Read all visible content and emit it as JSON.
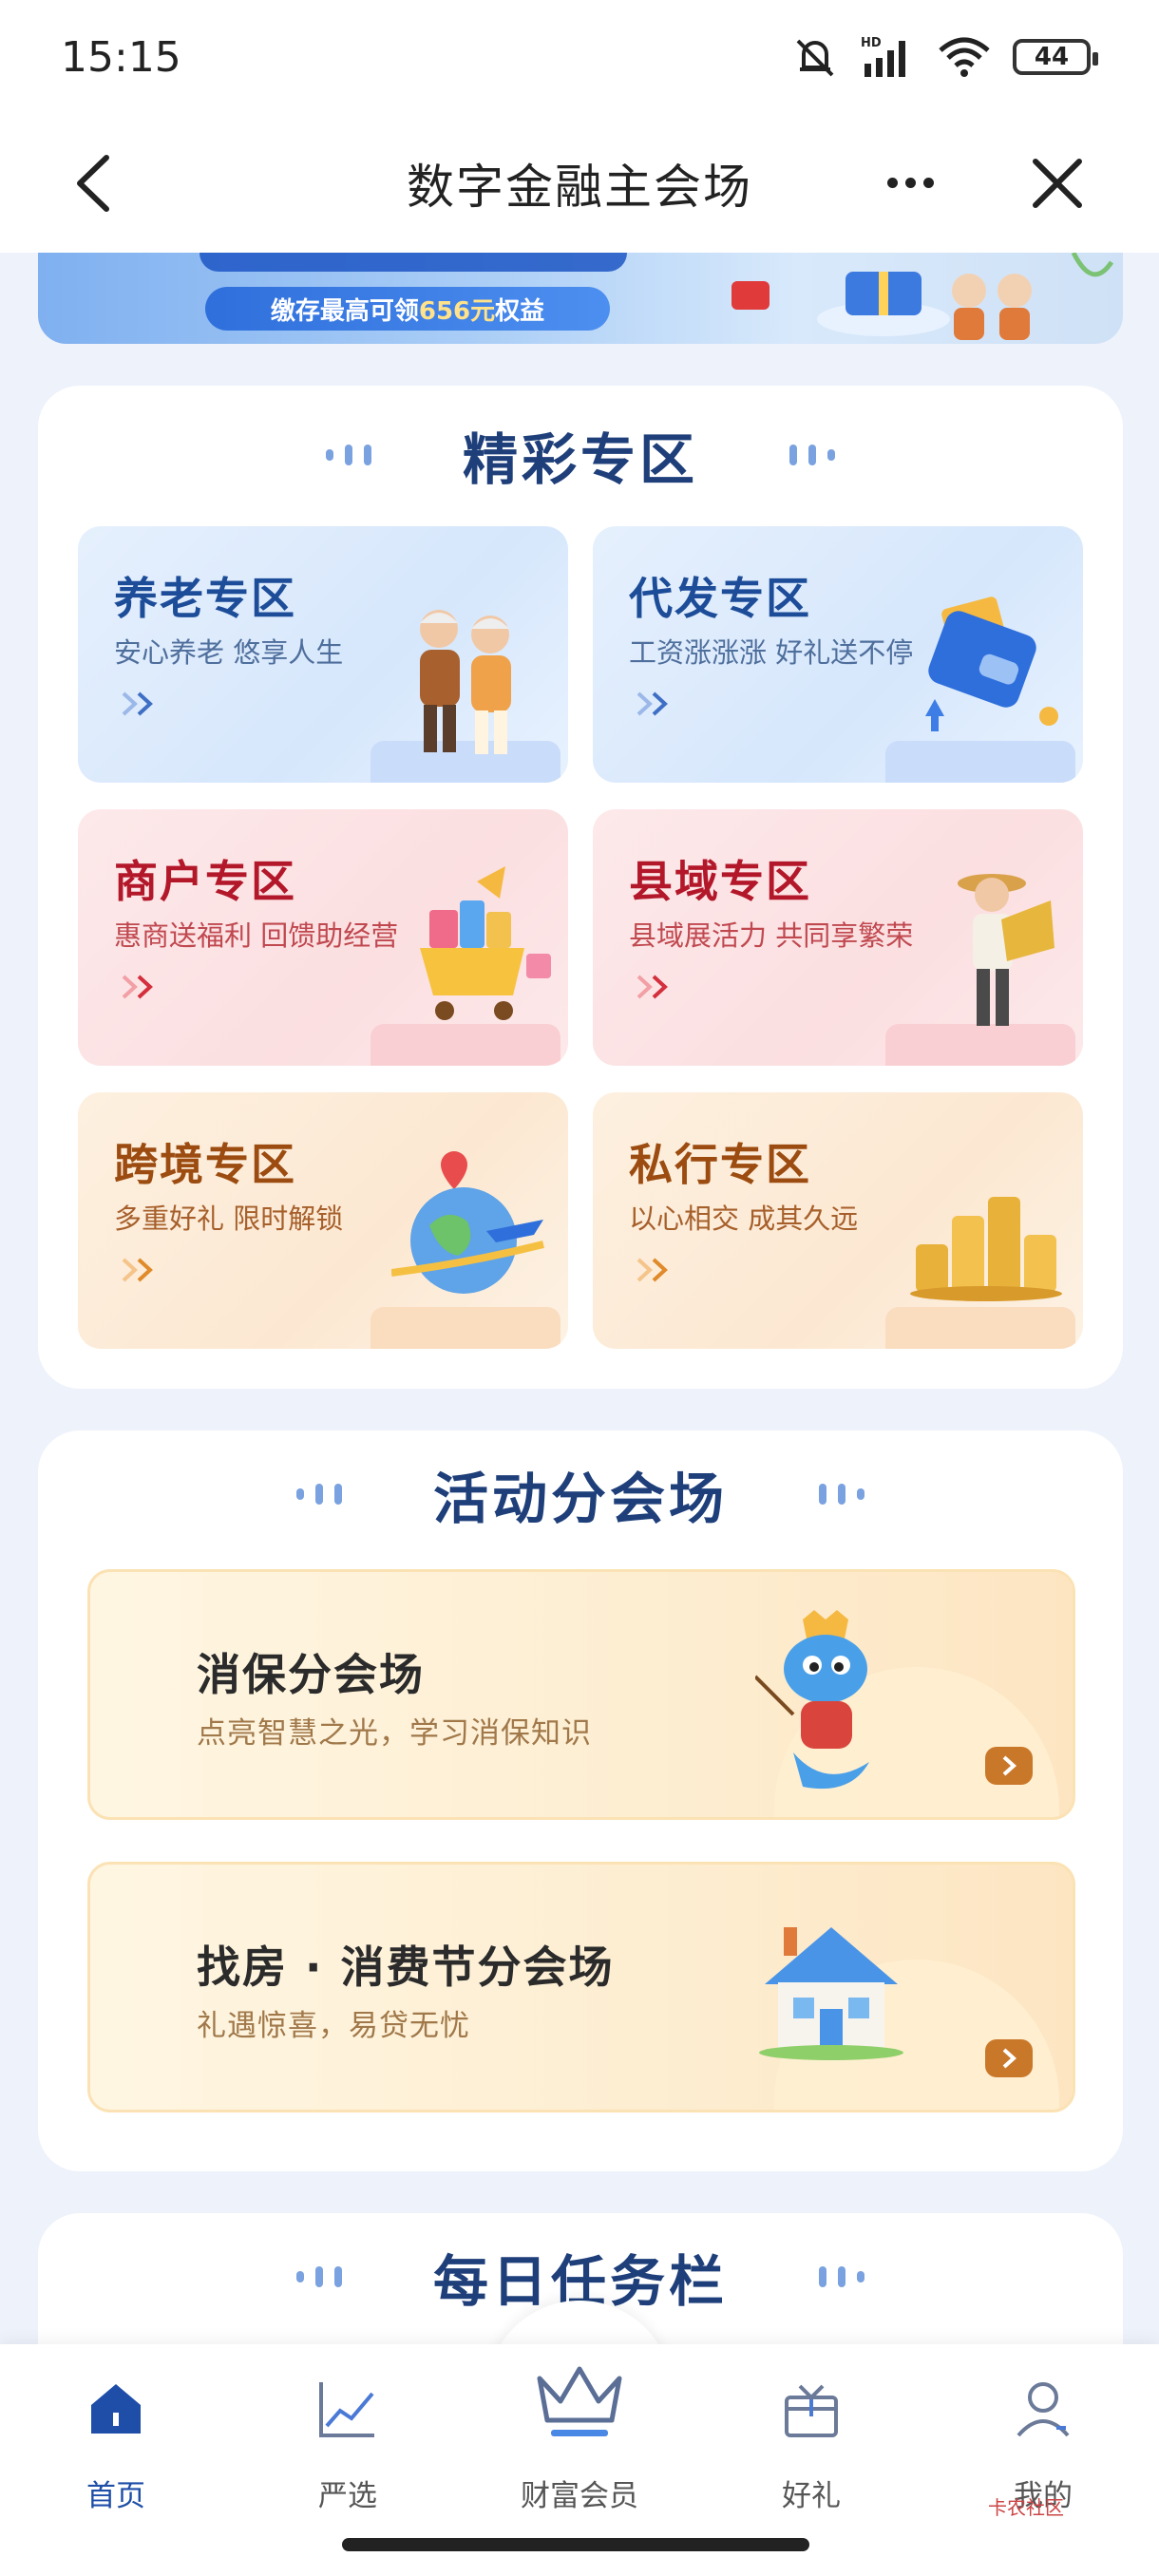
{
  "status": {
    "time": "15:15",
    "battery": "44",
    "network": "HD"
  },
  "nav": {
    "title": "数字金融主会场"
  },
  "banner": {
    "text_pre": "缴存最高可领",
    "text_highlight": "656元",
    "text_post": "权益"
  },
  "featured": {
    "title": "精彩专区",
    "zones": [
      {
        "title": "养老专区",
        "subtitle": "安心养老  悠享人生",
        "theme": "blue",
        "art": "elderly-couple-icon"
      },
      {
        "title": "代发专区",
        "subtitle": "工资涨涨涨  好礼送不停",
        "theme": "blue",
        "art": "wallet-icon"
      },
      {
        "title": "商户专区",
        "subtitle": "惠商送福利  回馈助经营",
        "theme": "pink",
        "art": "shopping-cart-icon"
      },
      {
        "title": "县域专区",
        "subtitle": "县域展活力  共同享繁荣",
        "theme": "pink",
        "art": "farmer-icon"
      },
      {
        "title": "跨境专区",
        "subtitle": "多重好礼  限时解锁",
        "theme": "peach",
        "art": "globe-plane-icon"
      },
      {
        "title": "私行专区",
        "subtitle": "以心相交  成其久远",
        "theme": "peach",
        "art": "gold-coins-icon"
      }
    ]
  },
  "activities": {
    "title": "活动分会场",
    "items": [
      {
        "title": "消保分会场",
        "subtitle": "点亮智慧之光，学习消保知识"
      },
      {
        "title": "找房 · 消费节分会场",
        "subtitle": "礼遇惊喜，易贷无忧"
      }
    ]
  },
  "daily": {
    "title": "每日任务栏"
  },
  "tabs": [
    {
      "label": "首页",
      "icon": "home-icon"
    },
    {
      "label": "严选",
      "icon": "chart-icon"
    },
    {
      "label": "财富会员",
      "icon": "crown-icon"
    },
    {
      "label": "好礼",
      "icon": "gift-icon"
    },
    {
      "label": "我的",
      "icon": "user-icon"
    }
  ],
  "watermark": "卡农社区"
}
